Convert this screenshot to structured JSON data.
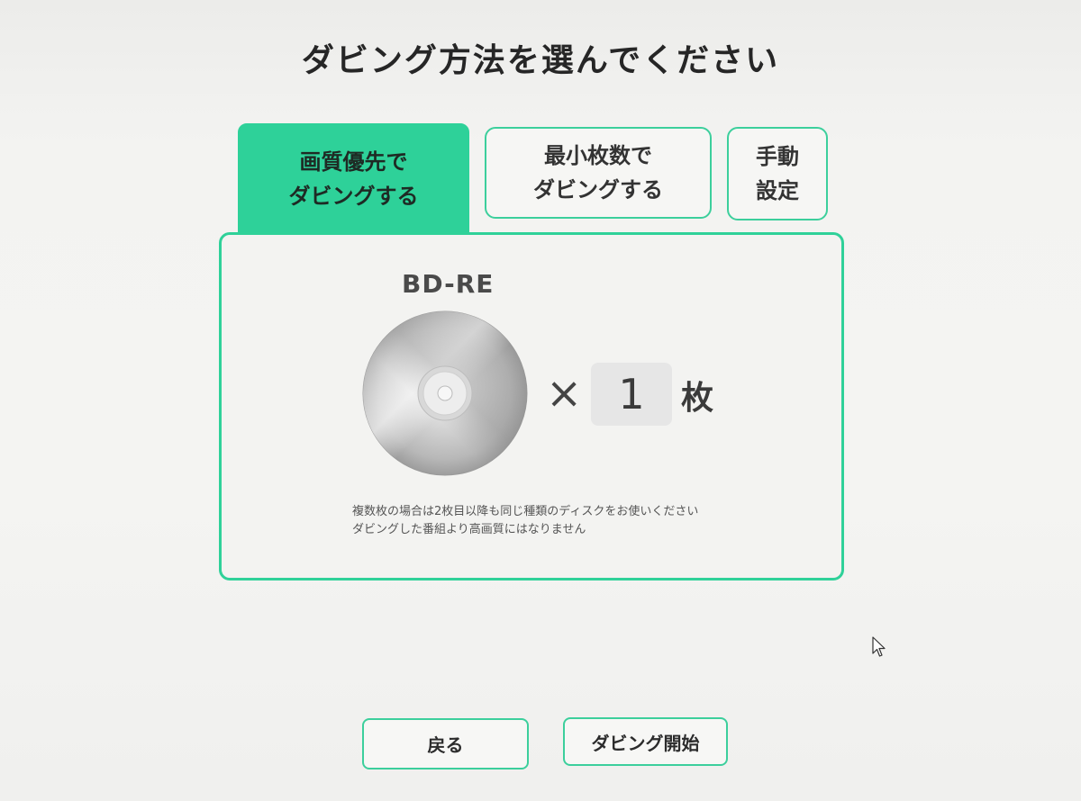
{
  "title": "ダビング方法を選んでください",
  "tabs": [
    {
      "line1": "画質優先で",
      "line2": "ダビングする",
      "active": true
    },
    {
      "line1": "最小枚数で",
      "line2": "ダビングする",
      "active": false
    },
    {
      "line1": "手動",
      "line2": "設定",
      "active": false
    }
  ],
  "media": {
    "type": "BD-RE",
    "times_sign": "×",
    "count": "1",
    "unit": "枚"
  },
  "notes": [
    "複数枚の場合は2枚目以降も同じ種類のディスクをお使いください",
    "ダビングした番組より高画質にはなりません"
  ],
  "buttons": {
    "back": "戻る",
    "start": "ダビング開始"
  },
  "colors": {
    "accent": "#2ed199",
    "count_box": "#e6e6e6"
  },
  "icons": {
    "disc": "disc-icon",
    "cursor": "mouse-pointer-icon"
  }
}
